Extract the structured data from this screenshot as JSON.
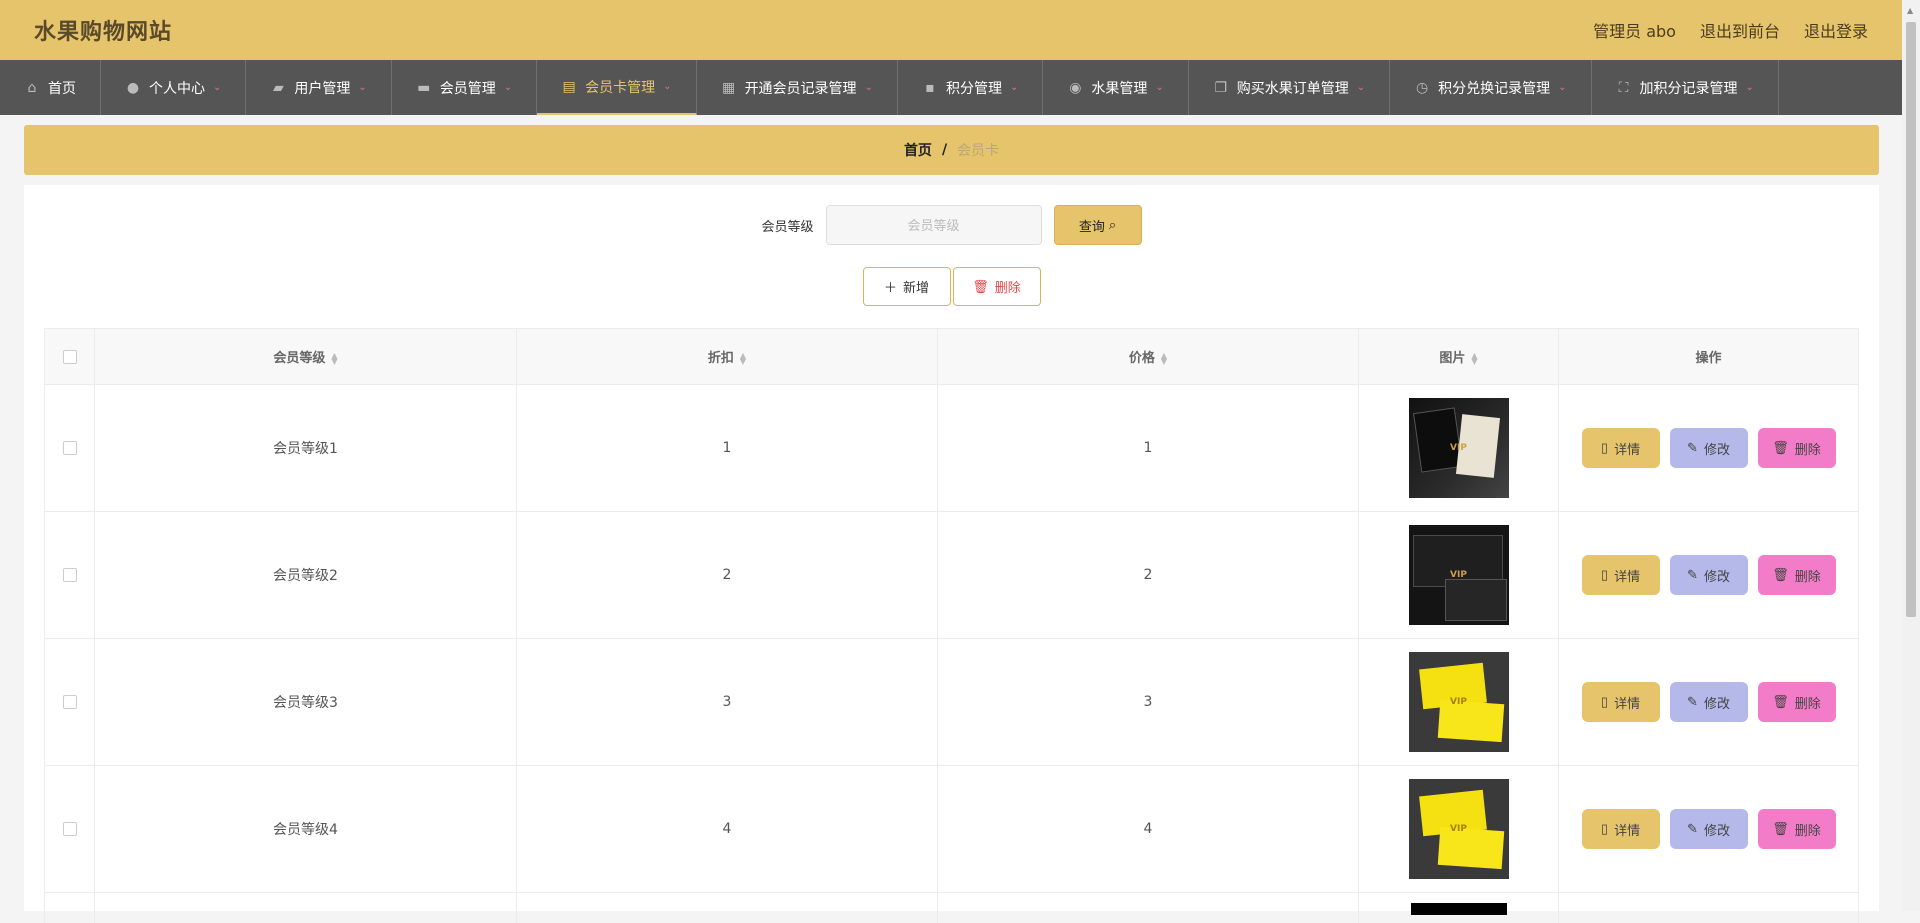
{
  "site": {
    "title": "水果购物网站",
    "admin_label": "管理员 abo",
    "front_label": "退出到前台",
    "logout_label": "退出登录"
  },
  "nav": [
    {
      "label": "首页",
      "icon": "home-icon",
      "glyph": "⌂",
      "has_caret": false
    },
    {
      "label": "个人中心",
      "icon": "user-icon",
      "glyph": "●",
      "has_caret": true
    },
    {
      "label": "用户管理",
      "icon": "ticket-icon",
      "glyph": "▰",
      "has_caret": true
    },
    {
      "label": "会员管理",
      "icon": "member-icon",
      "glyph": "▬",
      "has_caret": true
    },
    {
      "label": "会员卡管理",
      "icon": "clipboard-icon",
      "glyph": "▤",
      "has_caret": true,
      "active": true
    },
    {
      "label": "开通会员记录管理",
      "icon": "grid-icon",
      "glyph": "▦",
      "has_caret": true
    },
    {
      "label": "积分管理",
      "icon": "chat-icon",
      "glyph": "▪",
      "has_caret": true
    },
    {
      "label": "水果管理",
      "icon": "location-icon",
      "glyph": "◉",
      "has_caret": true
    },
    {
      "label": "购买水果订单管理",
      "icon": "copy-icon",
      "glyph": "❐",
      "has_caret": true
    },
    {
      "label": "积分兑换记录管理",
      "icon": "clock-icon",
      "glyph": "◷",
      "has_caret": true
    },
    {
      "label": "加积分记录管理",
      "icon": "fullscreen-icon",
      "glyph": "⛶",
      "has_caret": true
    }
  ],
  "breadcrumb": {
    "home": "首页",
    "separator": "/",
    "current": "会员卡"
  },
  "search": {
    "label": "会员等级",
    "placeholder": "会员等级",
    "query_label": "查询",
    "query_icon": "search-icon"
  },
  "actions": {
    "add_label": "新增",
    "delete_label": "删除"
  },
  "table": {
    "headers": {
      "level": "会员等级",
      "discount": "折扣",
      "price": "价格",
      "image": "图片",
      "ops": "操作"
    },
    "rows": [
      {
        "level": "会员等级1",
        "discount": "1",
        "price": "1",
        "thumb_mark": "VIP"
      },
      {
        "level": "会员等级2",
        "discount": "2",
        "price": "2",
        "thumb_mark": "VIP"
      },
      {
        "level": "会员等级3",
        "discount": "3",
        "price": "3",
        "thumb_mark": "VIP"
      },
      {
        "level": "会员等级4",
        "discount": "4",
        "price": "4",
        "thumb_mark": "VIP"
      }
    ],
    "op_labels": {
      "detail": "详情",
      "edit": "修改",
      "delete": "删除"
    }
  },
  "colors": {
    "accent": "#e6c46c",
    "nav_bg": "#555555",
    "edit_btn": "#b4b9e9",
    "delete_btn": "#f27cc7",
    "danger_text": "#e24a4a"
  }
}
